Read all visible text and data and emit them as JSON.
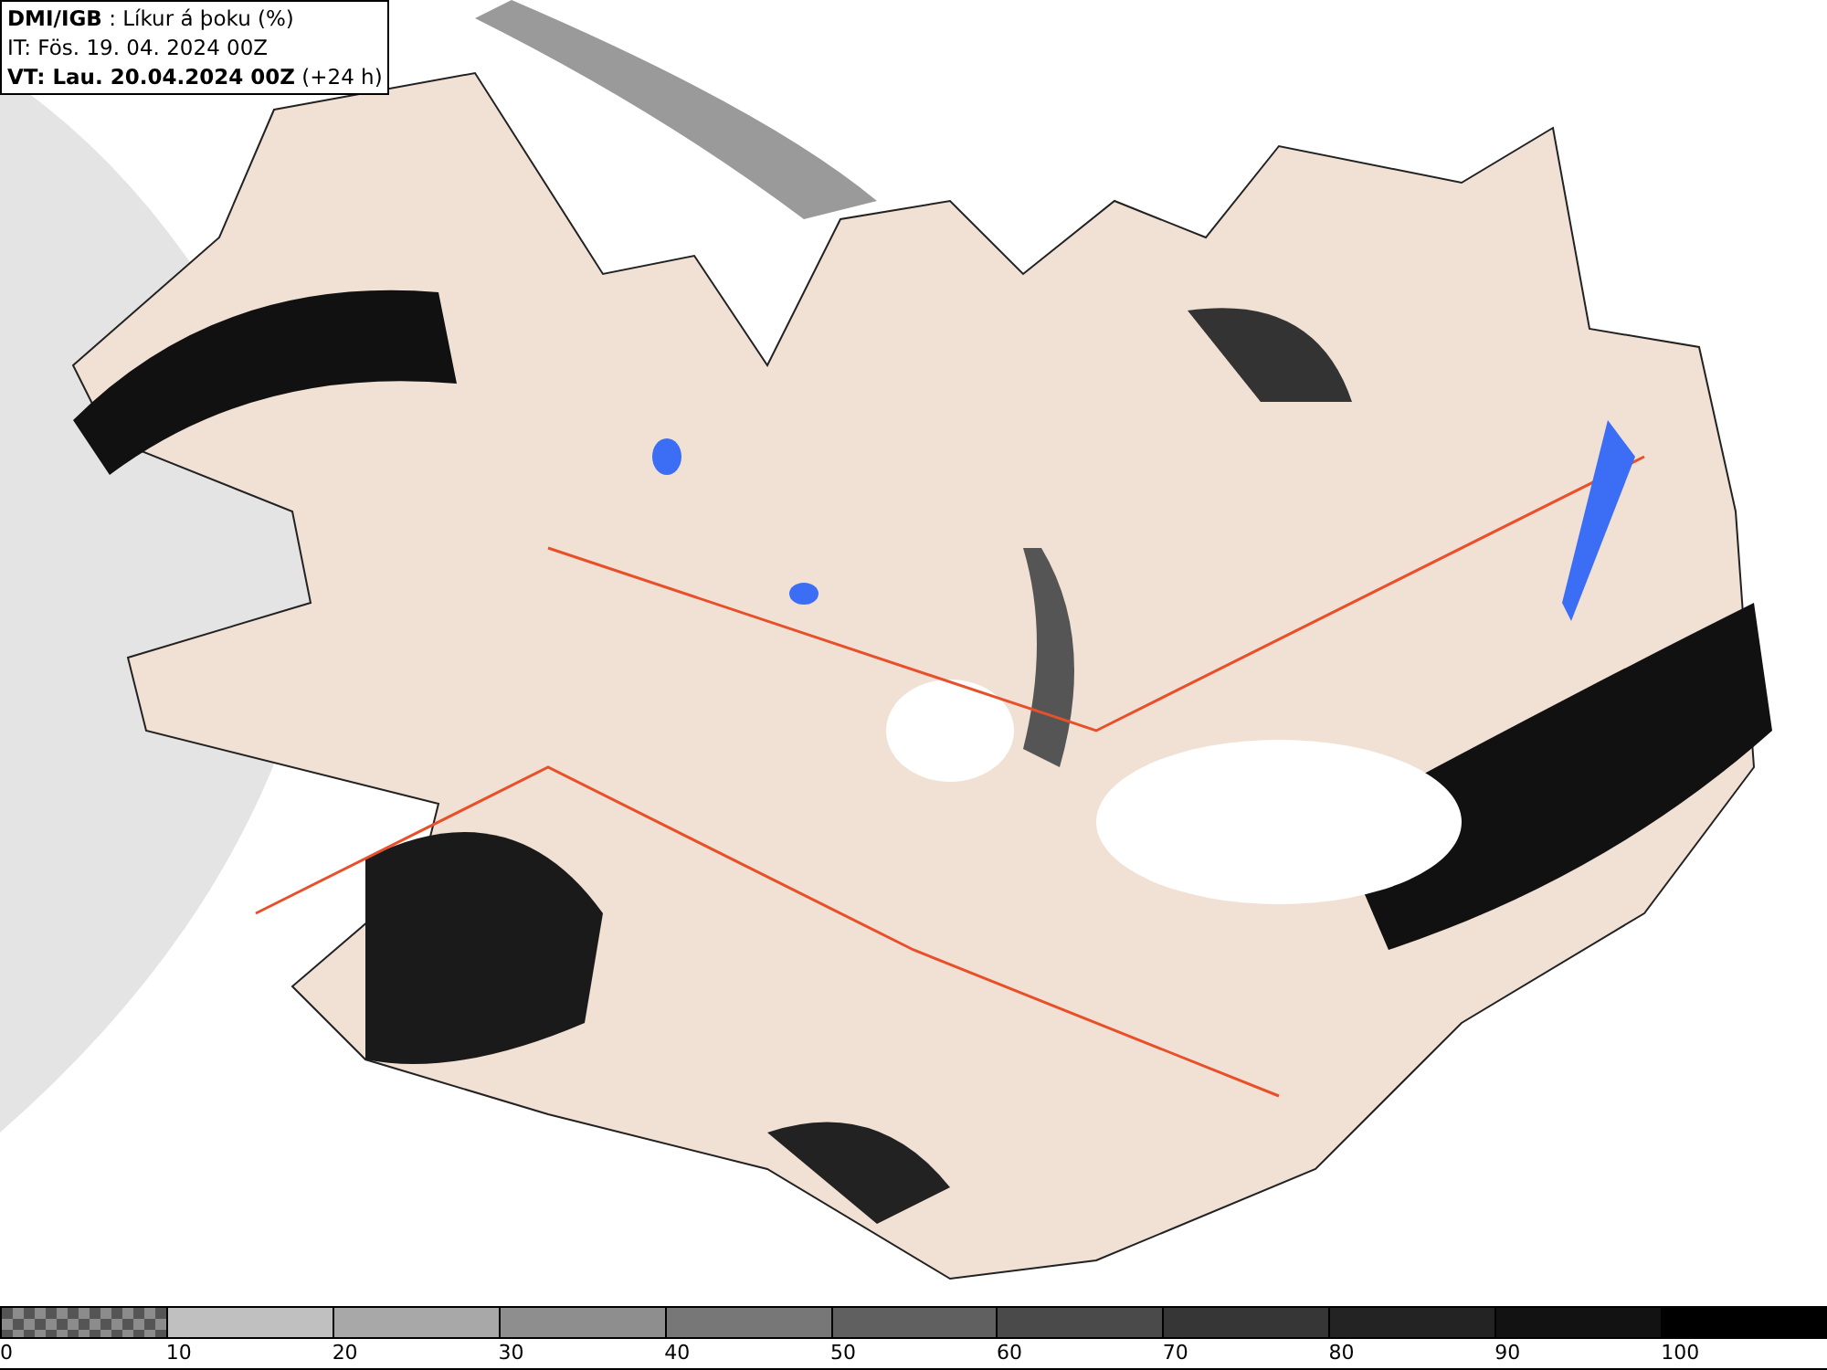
{
  "header": {
    "lines": [
      "**DMI/IGB** : Líkur á þoku (%)",
      "IT: Fös. 19. 04. 2024 00Z",
      "**VT: Lau. 20.04.2024 00Z** (+24 h)"
    ]
  },
  "legend": {
    "segments": [
      {
        "kind": "checker",
        "color": "#8c8c8c"
      },
      {
        "kind": "solid",
        "color": "#c0c0c0"
      },
      {
        "kind": "solid",
        "color": "#a8a8a8"
      },
      {
        "kind": "solid",
        "color": "#8e8e8e"
      },
      {
        "kind": "solid",
        "color": "#777777"
      },
      {
        "kind": "solid",
        "color": "#606060"
      },
      {
        "kind": "solid",
        "color": "#4a4a4a"
      },
      {
        "kind": "solid",
        "color": "#363636"
      },
      {
        "kind": "solid",
        "color": "#232323"
      },
      {
        "kind": "solid",
        "color": "#121212"
      },
      {
        "kind": "solid",
        "color": "#000000"
      }
    ],
    "labels": [
      "0",
      "10",
      "20",
      "30",
      "40",
      "50",
      "60",
      "70",
      "80",
      "90",
      "100"
    ]
  }
}
